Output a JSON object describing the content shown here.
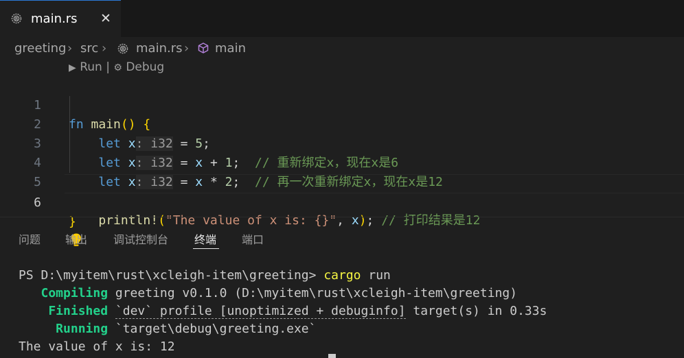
{
  "tab": {
    "label": "main.rs",
    "close": "✕"
  },
  "breadcrumb": {
    "folder1": "greeting",
    "folder2": "src",
    "file": "main.rs",
    "symbol": "main",
    "sep": "›"
  },
  "codelens": {
    "run": "Run",
    "sep": "|",
    "debug": "Debug"
  },
  "editor": {
    "active_line": 6,
    "lines": [
      {
        "num": "1"
      },
      {
        "num": "2"
      },
      {
        "num": "3"
      },
      {
        "num": "4"
      },
      {
        "num": "5"
      },
      {
        "num": "6"
      }
    ],
    "tokens": {
      "fn": "fn",
      "main": "main",
      "lparen": "(",
      "rparen": ")",
      "lbrace": "{",
      "rbrace": "}",
      "let": "let",
      "x": "x",
      "colon_hint": ": ",
      "i32": "i32",
      "eq": " = ",
      "five": "5",
      "semi": ";",
      "plus": " + ",
      "one": "1",
      "star": " * ",
      "two": "2",
      "comment3": "// 重新绑定x，现在x是6",
      "comment4": "// 再一次重新绑定x，现在x是12",
      "println": "println!",
      "str": "\"The value of x is: {}\"",
      "comma": ", ",
      "comment5": "// 打印结果是12"
    }
  },
  "panel": {
    "tabs": [
      "问题",
      "输出",
      "调试控制台",
      "终端",
      "端口"
    ],
    "active_tab": "终端"
  },
  "terminal": {
    "prompt": "PS D:\\myitem\\rust\\xcleigh-item\\greeting> ",
    "cmd": "cargo",
    "cmd_arg": " run",
    "compiling_label": "   Compiling",
    "compiling_text": " greeting v0.1.0 (D:\\myitem\\rust\\xcleigh-item\\greeting)",
    "finished_label": "    Finished",
    "finished_profile": "`dev` profile [unoptimized + debuginfo]",
    "finished_rest": " target(s) in 0.33s",
    "running_label": "     Running",
    "running_text": " `target\\debug\\greeting.exe`",
    "output": "The value of x is: 12"
  },
  "colors": {
    "accent": "#2b79d8",
    "keyword": "#569cd6",
    "comment": "#6a9955",
    "terminal_green": "#23d18b"
  }
}
